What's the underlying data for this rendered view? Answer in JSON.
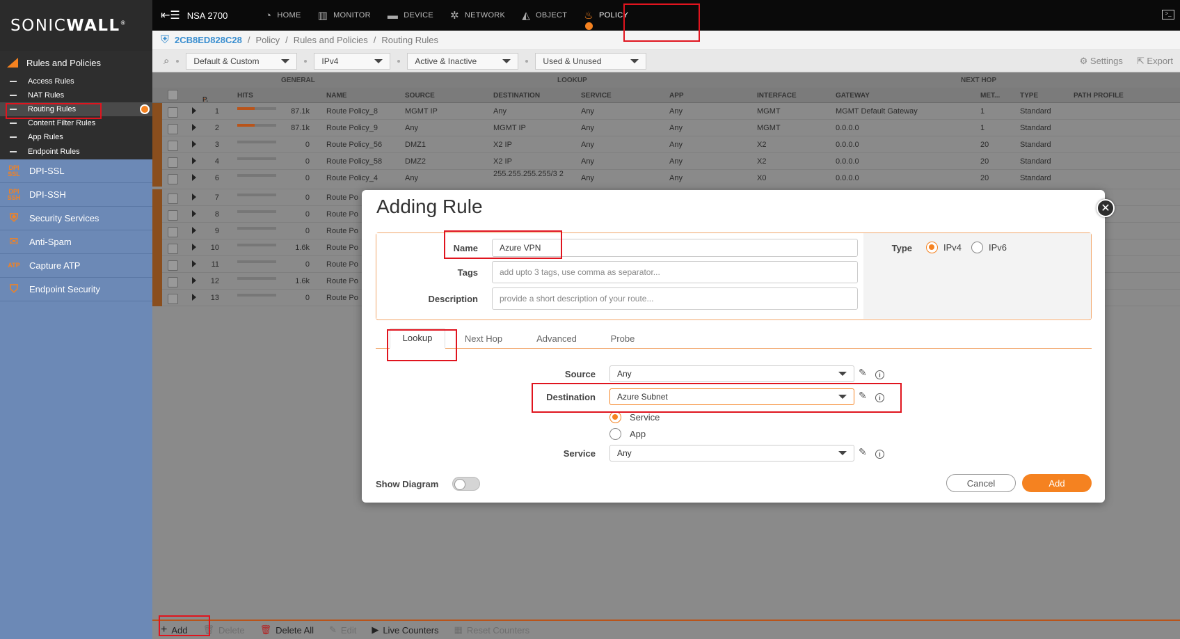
{
  "brand": {
    "logo_pre": "SONIC",
    "logo_bold": "WALL",
    "logo_mark": "®"
  },
  "topbar": {
    "device": "NSA 2700",
    "nav": [
      {
        "label": "HOME",
        "icon": "home-gauge-icon"
      },
      {
        "label": "MONITOR",
        "icon": "monitor-chart-icon"
      },
      {
        "label": "DEVICE",
        "icon": "device-icon"
      },
      {
        "label": "NETWORK",
        "icon": "network-icon"
      },
      {
        "label": "OBJECT",
        "icon": "object-icon"
      },
      {
        "label": "POLICY",
        "icon": "policy-fire-icon",
        "active": true
      }
    ]
  },
  "breadcrumb": {
    "device": "2CB8ED828C28",
    "items": [
      "Policy",
      "Rules and Policies",
      "Routing Rules"
    ],
    "sep": "/"
  },
  "sidebar": {
    "section": "Rules and Policies",
    "sub_items": [
      "Access Rules",
      "NAT Rules",
      "Routing Rules",
      "Content Filter Rules",
      "App Rules",
      "Endpoint Rules"
    ],
    "active_sub": "Routing Rules",
    "items": [
      {
        "label": "DPI-SSL",
        "icon_text": "DPI SSL"
      },
      {
        "label": "DPI-SSH",
        "icon_text": "DPI SSH"
      },
      {
        "label": "Security Services",
        "icon_text": "⛨"
      },
      {
        "label": "Anti-Spam",
        "icon_text": "✉"
      },
      {
        "label": "Capture ATP",
        "icon_text": "ATP"
      },
      {
        "label": "Endpoint Security",
        "icon_text": "⛉"
      }
    ]
  },
  "filters": {
    "f1": "Default & Custom",
    "f2": "IPv4",
    "f3": "Active & Inactive",
    "f4": "Used & Unused",
    "settings": "Settings",
    "export": "Export"
  },
  "table": {
    "groups": {
      "general": "GENERAL",
      "lookup": "LOOKUP",
      "nexthop": "NEXT HOP"
    },
    "columns": {
      "p": "P.",
      "hits": "HITS",
      "name": "NAME",
      "source": "SOURCE",
      "destination": "DESTINATION",
      "service": "SERVICE",
      "app": "APP",
      "interface": "INTERFACE",
      "gateway": "GATEWAY",
      "metric": "MET...",
      "type": "TYPE",
      "path": "PATH PROFILE"
    },
    "rows": [
      {
        "p": "1",
        "hits": "87.1k",
        "bar": 0.45,
        "name": "Route Policy_8",
        "source": "MGMT IP",
        "destination": "Any",
        "service": "Any",
        "app": "Any",
        "interface": "MGMT",
        "gateway": "MGMT Default Gateway",
        "metric": "1",
        "type": "Standard"
      },
      {
        "p": "2",
        "hits": "87.1k",
        "bar": 0.45,
        "name": "Route Policy_9",
        "source": "Any",
        "destination": "MGMT IP",
        "service": "Any",
        "app": "Any",
        "interface": "MGMT",
        "gateway": "0.0.0.0",
        "metric": "1",
        "type": "Standard"
      },
      {
        "p": "3",
        "hits": "0",
        "bar": 0,
        "name": "Route Policy_56",
        "source": "DMZ1",
        "destination": "X2 IP",
        "service": "Any",
        "app": "Any",
        "interface": "X2",
        "gateway": "0.0.0.0",
        "metric": "20",
        "type": "Standard"
      },
      {
        "p": "4",
        "hits": "0",
        "bar": 0,
        "name": "Route Policy_58",
        "source": "DMZ2",
        "destination": "X2 IP",
        "service": "Any",
        "app": "Any",
        "interface": "X2",
        "gateway": "0.0.0.0",
        "metric": "20",
        "type": "Standard"
      },
      {
        "p": "6",
        "hits": "0",
        "bar": 0,
        "name": "Route Policy_4",
        "source": "Any",
        "destination": "255.255.255.255/3",
        "service": "Any",
        "app": "Any",
        "interface": "X0",
        "gateway": "0.0.0.0",
        "metric": "20",
        "type": "Standard"
      },
      {
        "p": "7",
        "hits": "0",
        "bar": 0,
        "name": "Route Po"
      },
      {
        "p": "8",
        "hits": "0",
        "bar": 0,
        "name": "Route Po"
      },
      {
        "p": "9",
        "hits": "0",
        "bar": 0,
        "name": "Route Po"
      },
      {
        "p": "10",
        "hits": "1.6k",
        "bar": 0,
        "name": "Route Po"
      },
      {
        "p": "11",
        "hits": "0",
        "bar": 0,
        "name": "Route Po"
      },
      {
        "p": "12",
        "hits": "1.6k",
        "bar": 0,
        "name": "Route Po"
      },
      {
        "p": "13",
        "hits": "0",
        "bar": 0,
        "name": "Route Po"
      }
    ]
  },
  "bottombar": {
    "add": "Add",
    "delete": "Delete",
    "delete_all": "Delete All",
    "edit": "Edit",
    "live": "Live Counters",
    "reset": "Reset Counters"
  },
  "modal": {
    "title": "Adding Rule",
    "name_label": "Name",
    "name_value": "Azure VPN",
    "tags_label": "Tags",
    "tags_placeholder": "add upto 3 tags, use comma as separator...",
    "desc_label": "Description",
    "desc_placeholder": "provide a short description of your route...",
    "type_label": "Type",
    "type_ipv4": "IPv4",
    "type_ipv6": "IPv6",
    "tabs": [
      "Lookup",
      "Next Hop",
      "Advanced",
      "Probe"
    ],
    "source_label": "Source",
    "source_value": "Any",
    "destination_label": "Destination",
    "destination_value": "Azure Subnet",
    "opt_service": "Service",
    "opt_app": "App",
    "service_label": "Service",
    "service_value": "Any",
    "show_diagram": "Show Diagram",
    "cancel": "Cancel",
    "add": "Add"
  }
}
